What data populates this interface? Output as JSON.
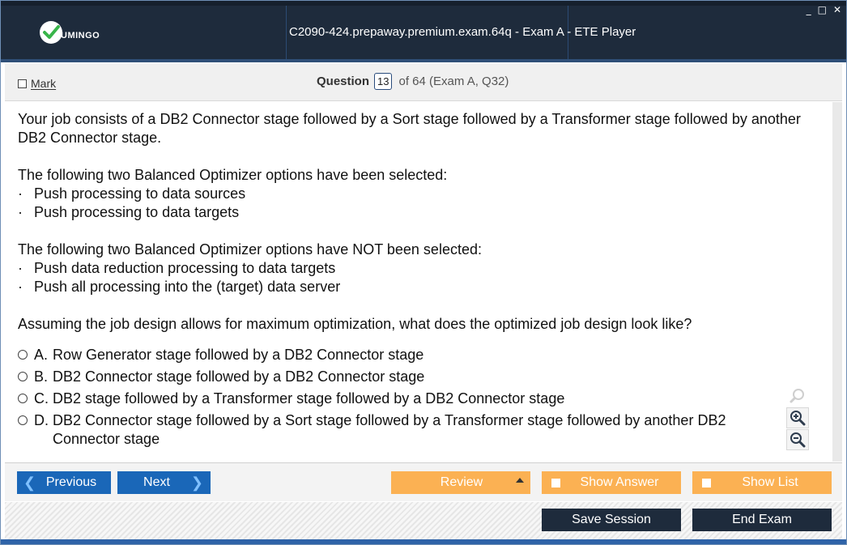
{
  "app": {
    "logo_text": "UMINGO",
    "title": "C2090-424.prepaway.premium.exam.64q - Exam A - ETE Player",
    "window_controls": [
      "_",
      "□",
      "✕"
    ]
  },
  "header": {
    "mark_label": "Mark",
    "question_label": "Question",
    "question_number": "13",
    "question_of": "of 64 (Exam A, Q32)"
  },
  "question": {
    "intro": "Your job consists of a DB2 Connector stage followed by a Sort stage followed by a Transformer stage followed by another DB2 Connector stage.",
    "selected_heading": "The following two Balanced Optimizer options have been selected:",
    "selected": [
      "Push processing to data sources",
      "Push processing to data targets"
    ],
    "not_selected_heading": "The following two Balanced Optimizer options have NOT been selected:",
    "not_selected": [
      "Push data reduction processing to data targets",
      "Push all processing into the (target) data server"
    ],
    "prompt": "Assuming the job design allows for maximum optimization, what does the optimized job design look like?",
    "bullet_symbol": "·",
    "options": [
      {
        "letter": "A.",
        "text": "Row Generator stage followed by a DB2 Connector stage"
      },
      {
        "letter": "B.",
        "text": "DB2 Connector stage followed by a DB2 Connector stage"
      },
      {
        "letter": "C.",
        "text": "DB2 stage followed by a Transformer stage followed by a DB2 Connector stage"
      },
      {
        "letter": "D.",
        "text": "DB2 Connector stage followed by a Sort stage followed by a Transformer stage followed by another DB2 Connector stage"
      }
    ]
  },
  "nav": {
    "previous": "Previous",
    "next": "Next",
    "review": "Review",
    "show_answer": "Show Answer",
    "show_list": "Show List",
    "save_session": "Save Session",
    "end_exam": "End Exam"
  },
  "icons": {
    "zoom_search": "magnifier-icon",
    "zoom_in": "zoom-in-icon",
    "zoom_out": "zoom-out-icon",
    "logo": "check-logo-icon"
  },
  "colors": {
    "titlebar": "#1e2b3c",
    "accent_blue": "#1a67b8",
    "orange": "#fbb153",
    "logo_green": "#39b54a"
  }
}
